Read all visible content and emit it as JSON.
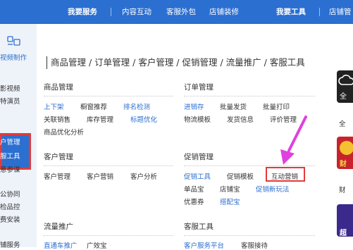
{
  "topnav": {
    "services": "我要服务",
    "content_interaction": "内容互动",
    "outsourcing": "客服外包",
    "decoration": "店铺装修",
    "tools": "我要工具",
    "shop_manage": "店铺管"
  },
  "leftpanel": {
    "items": [
      "视频制作",
      "影视频",
      "特演员",
      "户管理",
      "服工具",
      "意参谋",
      "公协同",
      "检品控",
      "费安装",
      "铺服务"
    ]
  },
  "breadcrumb": "商品管理 / 订单管理 / 客户管理 / 促销管理 / 流量推广 / 客服工具",
  "sections": {
    "goods": {
      "title": "商品管理",
      "row1": [
        "上下架",
        "橱窗推荐",
        "排名检测"
      ],
      "row2": [
        "关联销售",
        "库存管理",
        "标题优化"
      ],
      "row3": [
        "商品优化分析"
      ]
    },
    "orders": {
      "title": "订单管理",
      "row1": [
        "进销存",
        "批量发货",
        "批量打印"
      ],
      "row2": [
        "物流模板",
        "发货信息",
        "评价管理"
      ]
    },
    "customers": {
      "title": "客户管理",
      "row1": [
        "客户管理",
        "客户营销",
        "客户分析"
      ]
    },
    "promotion": {
      "title": "促销管理",
      "row1": [
        "促销工具",
        "促销模板",
        "互动营销"
      ],
      "row2": [
        "单品宝",
        "店铺宝",
        "促销新玩法"
      ],
      "row3": [
        "优惠券",
        "搭配宝"
      ]
    },
    "traffic": {
      "title": "流量推广",
      "row1": [
        "直通车推广",
        "广效宝"
      ]
    },
    "cs_tools": {
      "title": "客服工具",
      "row1": [
        "客户服务平台",
        "客服接待"
      ]
    }
  },
  "rightpanel": {
    "item1": "全",
    "item2": "财",
    "item2_sub": "财",
    "item3": "超"
  },
  "colors": {
    "topbar": "#2b6fd0",
    "link": "#2b6fd0",
    "highlight": "#e23b3b",
    "arrow": "#e040e0"
  }
}
